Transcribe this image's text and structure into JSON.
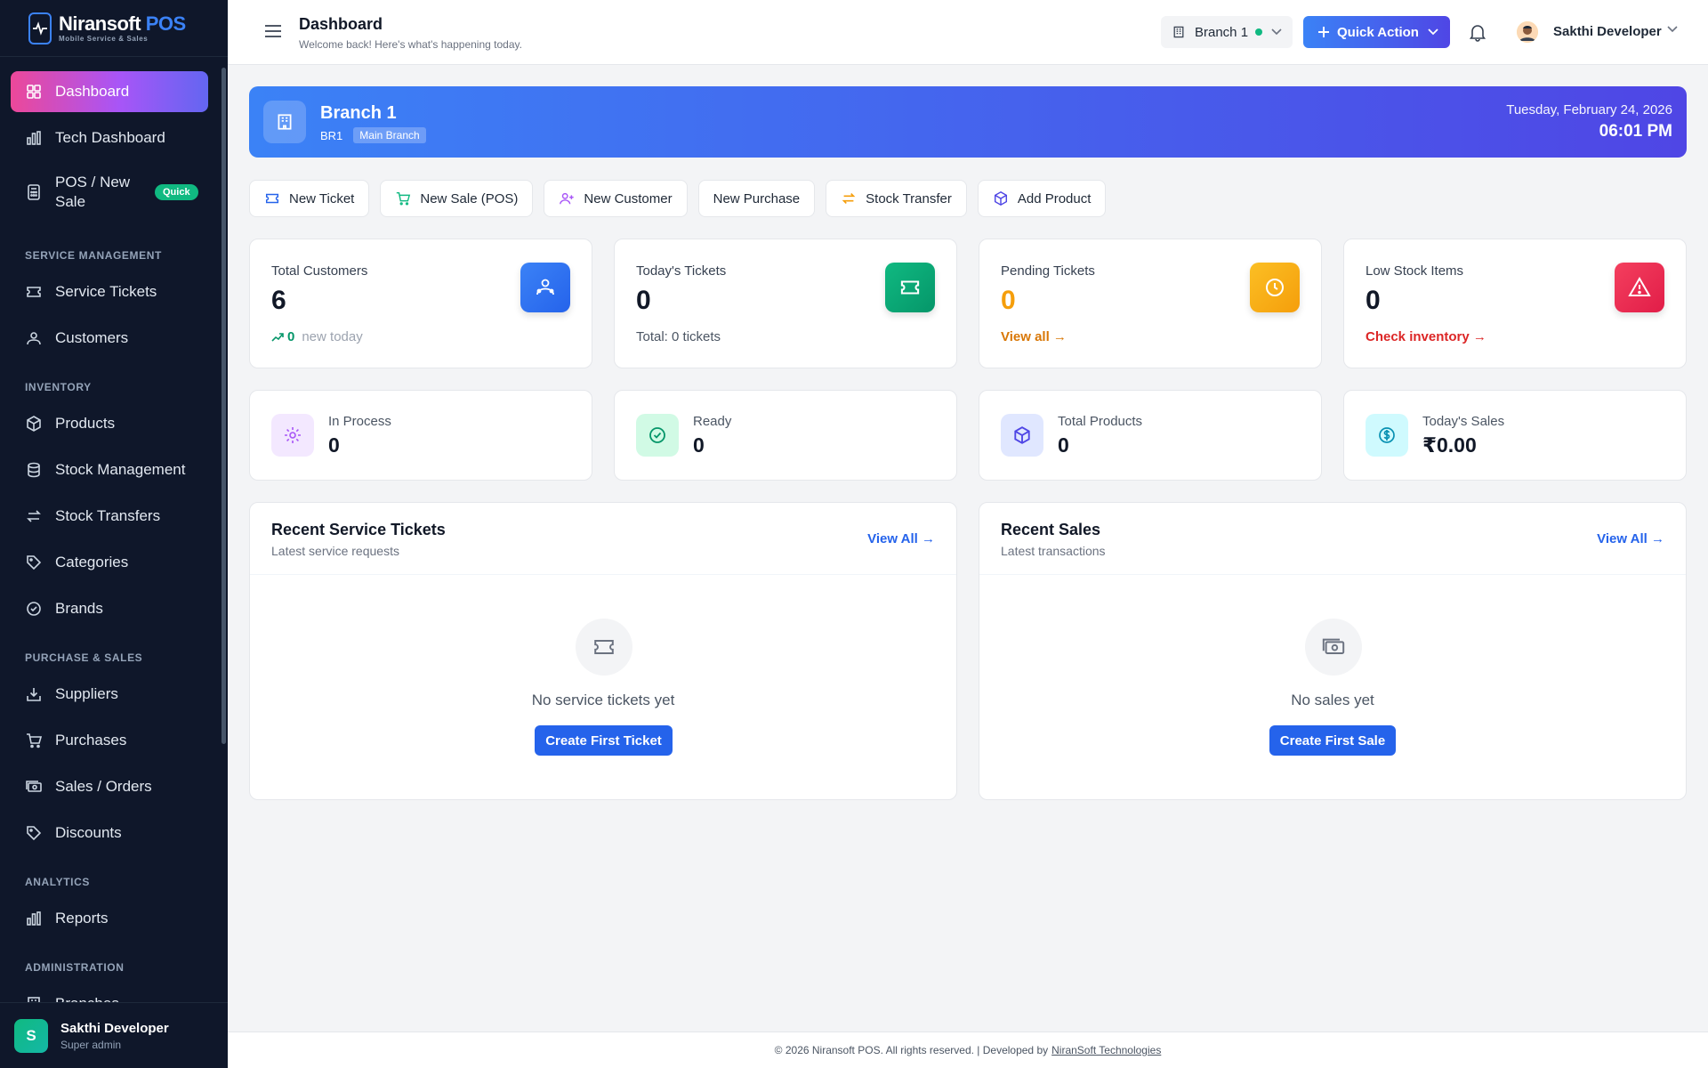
{
  "app": {
    "brand_main": "Niransoft",
    "brand_accent": "POS",
    "brand_sub": "Mobile Service & Sales"
  },
  "sidebar": {
    "items_top": [
      {
        "label": "Dashboard",
        "icon": "grid-icon"
      },
      {
        "label": "Tech Dashboard",
        "icon": "bar-chart-icon"
      },
      {
        "label": "POS / New Sale",
        "icon": "calculator-icon",
        "badge": "Quick"
      }
    ],
    "sections": {
      "service": "SERVICE MANAGEMENT",
      "inventory": "INVENTORY",
      "purchase": "PURCHASE & SALES",
      "analytics": "ANALYTICS",
      "admin": "ADMINISTRATION"
    },
    "service_items": [
      {
        "label": "Service Tickets",
        "icon": "ticket-icon"
      },
      {
        "label": "Customers",
        "icon": "users-icon"
      }
    ],
    "inventory_items": [
      {
        "label": "Products",
        "icon": "cube-icon"
      },
      {
        "label": "Stock Management",
        "icon": "database-icon"
      },
      {
        "label": "Stock Transfers",
        "icon": "transfer-icon"
      },
      {
        "label": "Categories",
        "icon": "tag-icon"
      },
      {
        "label": "Brands",
        "icon": "badge-check-icon"
      }
    ],
    "purchase_items": [
      {
        "label": "Suppliers",
        "icon": "inbox-download-icon"
      },
      {
        "label": "Purchases",
        "icon": "cart-icon"
      },
      {
        "label": "Sales / Orders",
        "icon": "cash-icon"
      },
      {
        "label": "Discounts",
        "icon": "discount-tag-icon"
      }
    ],
    "analytics_items": [
      {
        "label": "Reports",
        "icon": "bar-chart-icon"
      }
    ],
    "admin_items": [
      {
        "label": "Branches",
        "icon": "building-icon"
      }
    ],
    "user": {
      "initial": "S",
      "name": "Sakthi Developer",
      "role": "Super admin"
    }
  },
  "header": {
    "title": "Dashboard",
    "subtitle": "Welcome back! Here's what's happening today.",
    "branch": "Branch 1",
    "quick_action": "Quick Action",
    "user_name": "Sakthi Developer"
  },
  "banner": {
    "name": "Branch 1",
    "code": "BR1",
    "tag": "Main Branch",
    "date": "Tuesday, February 24, 2026",
    "time": "06:01 PM"
  },
  "quick_actions": [
    {
      "label": "New Ticket",
      "icon": "ticket-icon",
      "color": "#2563eb"
    },
    {
      "label": "New Sale (POS)",
      "icon": "cart-icon",
      "color": "#10b981"
    },
    {
      "label": "New Customer",
      "icon": "user-plus-icon",
      "color": "#a855f7"
    },
    {
      "label": "New Purchase",
      "icon": "",
      "color": ""
    },
    {
      "label": "Stock Transfer",
      "icon": "transfer-icon",
      "color": "#f59e0b"
    },
    {
      "label": "Add Product",
      "icon": "cube-icon",
      "color": "#4f46e5"
    }
  ],
  "stats": {
    "customers": {
      "label": "Total Customers",
      "value": "6",
      "foot_count": "0",
      "foot_text": "new today",
      "color": "#3b82f6"
    },
    "tickets": {
      "label": "Today's Tickets",
      "value": "0",
      "foot_text": "Total: 0 tickets",
      "color": "#10b981"
    },
    "pending": {
      "label": "Pending Tickets",
      "value": "0",
      "foot_text": "View all →",
      "color": "#f59e0b"
    },
    "low_stock": {
      "label": "Low Stock Items",
      "value": "0",
      "foot_text": "Check inventory →",
      "color": "#ef4444"
    }
  },
  "mini_stats": {
    "in_process": {
      "label": "In Process",
      "value": "0"
    },
    "ready": {
      "label": "Ready",
      "value": "0"
    },
    "total_products": {
      "label": "Total Products",
      "value": "0"
    },
    "todays_sales": {
      "label": "Today's Sales",
      "value": "₹0.00"
    }
  },
  "recent_tickets": {
    "title": "Recent Service Tickets",
    "subtitle": "Latest service requests",
    "link": "View All →",
    "empty": "No service tickets yet",
    "button": "Create First Ticket"
  },
  "recent_sales": {
    "title": "Recent Sales",
    "subtitle": "Latest transactions",
    "link": "View All →",
    "empty": "No sales yet",
    "button": "Create First Sale"
  },
  "footer": {
    "text": "© 2026 Niransoft POS. All rights reserved. | Developed by",
    "link": "NiranSoft Technologies"
  }
}
